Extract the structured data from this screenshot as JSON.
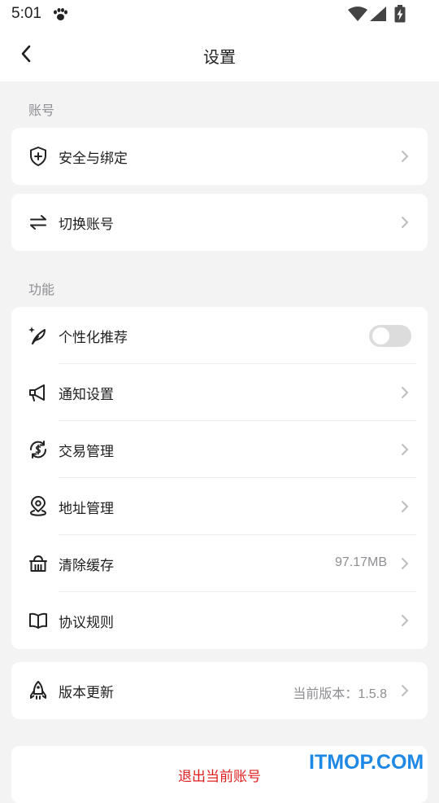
{
  "status_bar": {
    "time": "5:01",
    "icons": [
      "paw-icon",
      "wifi-icon",
      "signal-icon",
      "battery-charging-icon"
    ]
  },
  "nav": {
    "title": "设置",
    "back_icon": "chevron-left-icon"
  },
  "sections": {
    "account": {
      "label": "账号",
      "items": [
        {
          "label": "安全与绑定",
          "icon": "shield-plus-icon"
        },
        {
          "label": "切换账号",
          "icon": "swap-arrows-icon"
        }
      ]
    },
    "features": {
      "label": "功能",
      "items": [
        {
          "label": "个性化推荐",
          "icon": "feather-sparkle-icon",
          "toggle_on": false
        },
        {
          "label": "通知设置",
          "icon": "megaphone-icon"
        },
        {
          "label": "交易管理",
          "icon": "currency-cycle-icon"
        },
        {
          "label": "地址管理",
          "icon": "location-pin-icon"
        },
        {
          "label": "清除缓存",
          "icon": "basket-icon",
          "value": "97.17MB"
        },
        {
          "label": "协议规则",
          "icon": "open-book-icon"
        }
      ]
    },
    "version": {
      "label": "版本更新",
      "icon": "rocket-icon",
      "value": "当前版本：1.5.8"
    }
  },
  "logout": {
    "label": "退出当前账号"
  },
  "watermark": "ITMOP.COM",
  "colors": {
    "background": "#f3f3f4",
    "card": "#ffffff",
    "danger": "#e02020",
    "watermark": "#1e88e5",
    "toggle_off": "#dcdcdc"
  }
}
